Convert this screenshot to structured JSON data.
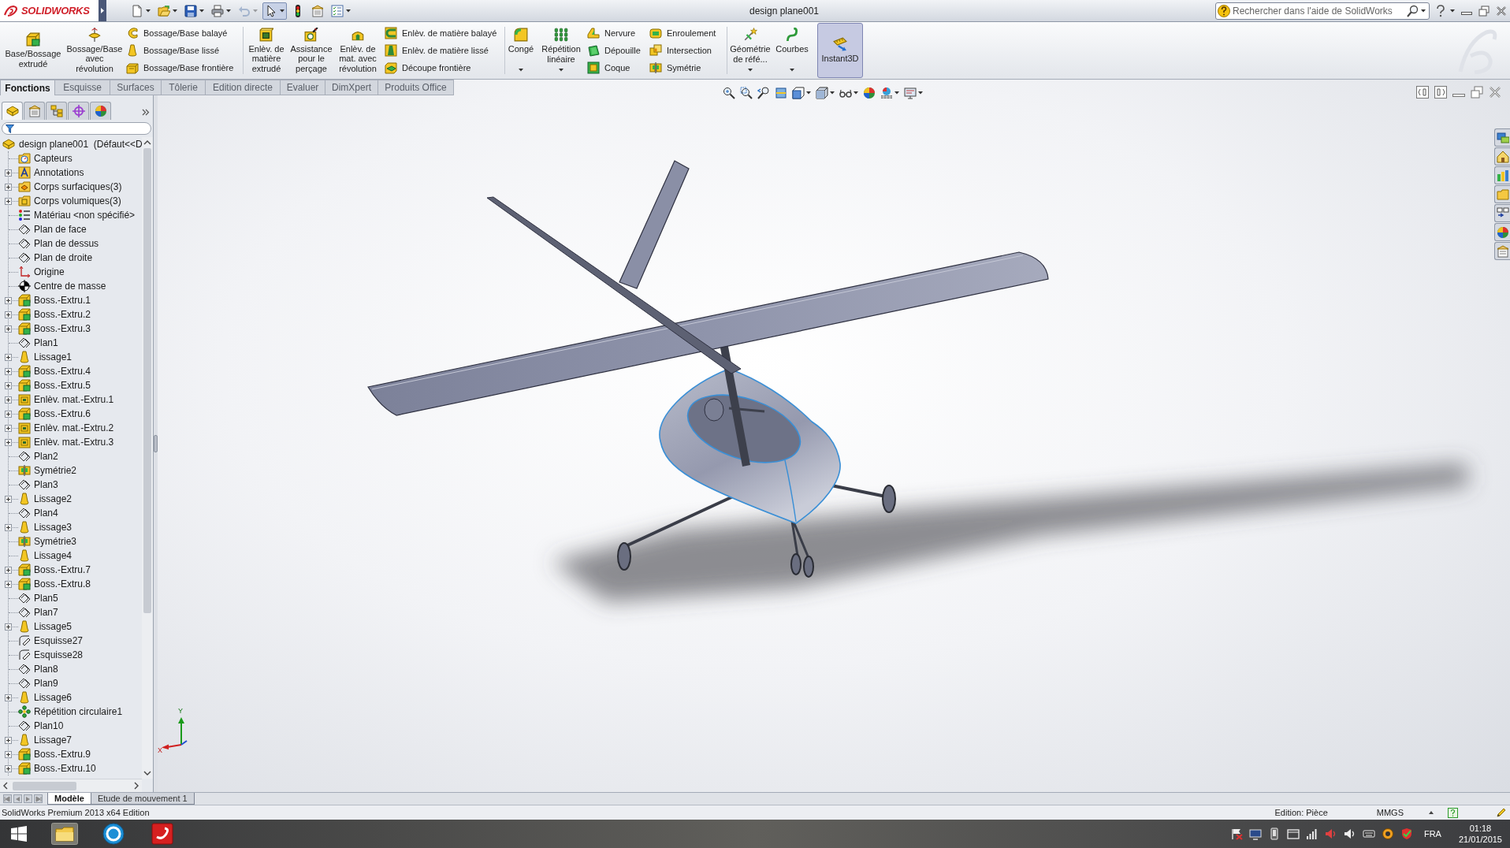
{
  "title_bar": {
    "logo": "SOLIDWORKS",
    "quick_access": [
      {
        "kind": "new",
        "dropdown": true,
        "on": false,
        "disabled": false
      },
      {
        "kind": "open",
        "dropdown": true,
        "on": false,
        "disabled": false
      },
      {
        "kind": "save",
        "dropdown": true,
        "on": false,
        "disabled": false
      },
      {
        "kind": "print",
        "dropdown": true,
        "on": false,
        "disabled": false
      },
      {
        "kind": "undo",
        "dropdown": true,
        "on": false,
        "disabled": true
      },
      {
        "kind": "select",
        "dropdown": true,
        "on": true,
        "disabled": false
      },
      {
        "kind": "rebuild",
        "dropdown": false,
        "on": false,
        "disabled": false
      },
      {
        "kind": "file-properties",
        "dropdown": false,
        "on": false,
        "disabled": false
      },
      {
        "kind": "options",
        "dropdown": true,
        "on": false,
        "disabled": false
      }
    ],
    "title": "design plane001",
    "search": {
      "placeholder": "Rechercher dans l'aide de SolidWorks"
    }
  },
  "ribbon": {
    "groups": [
      {
        "items": [
          {
            "kind": "large",
            "label": "Base/Bossage\nextrudé",
            "dropdown": false,
            "on": false
          },
          {
            "kind": "large",
            "label": "Bossage/Base\navec\nrévolution",
            "dropdown": false,
            "on": false
          },
          {
            "kind": "stack",
            "labels": [
              "Bossage/Base balayé",
              "Bossage/Base lissé",
              "Bossage/Base frontière"
            ]
          }
        ]
      },
      {
        "items": [
          {
            "kind": "large",
            "label": "Enlèv. de\nmatière\nextrudé",
            "dropdown": false,
            "on": false
          },
          {
            "kind": "large",
            "label": "Assistance\npour le\nperçage",
            "dropdown": false,
            "on": false
          },
          {
            "kind": "large",
            "label": "Enlèv. de\nmat. avec\nrévolution",
            "dropdown": false,
            "on": false
          },
          {
            "kind": "stack",
            "labels": [
              "Enlèv. de matière balayé",
              "Enlèv. de matière lissé",
              "Découpe frontière"
            ]
          }
        ]
      },
      {
        "items": [
          {
            "kind": "large",
            "label": "Congé",
            "dropdown": true,
            "on": false
          },
          {
            "kind": "large",
            "label": "Répétition\nlinéaire",
            "dropdown": true,
            "on": false
          },
          {
            "kind": "stack",
            "labels": [
              "Nervure",
              "Dépouille",
              "Coque"
            ]
          },
          {
            "kind": "stack",
            "labels": [
              "Enroulement",
              "Intersection",
              "Symétrie"
            ]
          }
        ]
      },
      {
        "items": [
          {
            "kind": "large",
            "label": "Géométrie\nde réfé...",
            "dropdown": true,
            "on": false
          },
          {
            "kind": "large",
            "label": "Courbes",
            "dropdown": true,
            "on": false
          },
          {
            "kind": "large",
            "label": "Instant3D",
            "dropdown": false,
            "on": true
          }
        ]
      }
    ]
  },
  "command_tabs": [
    {
      "label": "Fonctions",
      "selected": true
    },
    {
      "label": "Esquisse",
      "selected": false
    },
    {
      "label": "Surfaces",
      "selected": false
    },
    {
      "label": "Tôlerie",
      "selected": false
    },
    {
      "label": "Edition directe",
      "selected": false
    },
    {
      "label": "Evaluer",
      "selected": false
    },
    {
      "label": "DimXpert",
      "selected": false
    },
    {
      "label": "Produits Office",
      "selected": false
    }
  ],
  "feature_manager": {
    "tabs": [
      {
        "kind": "features",
        "selected": true
      },
      {
        "kind": "properties",
        "selected": false
      },
      {
        "kind": "configurations",
        "selected": false
      },
      {
        "kind": "dimxpert",
        "selected": false
      },
      {
        "kind": "display",
        "selected": false
      }
    ],
    "tree": {
      "label": "design plane001  (Défaut<<D",
      "kind": "part",
      "children": [
        {
          "label": "Capteurs",
          "kind": "sensors",
          "expandable": false
        },
        {
          "label": "Annotations",
          "kind": "annotations",
          "expandable": true
        },
        {
          "label": "Corps surfaciques(3)",
          "kind": "surface-bodies",
          "expandable": true
        },
        {
          "label": "Corps volumiques(3)",
          "kind": "solid-bodies",
          "expandable": true
        },
        {
          "label": "Matériau <non spécifié>",
          "kind": "material",
          "expandable": false
        },
        {
          "label": "Plan de face",
          "kind": "plane",
          "expandable": false
        },
        {
          "label": "Plan de dessus",
          "kind": "plane",
          "expandable": false
        },
        {
          "label": "Plan de droite",
          "kind": "plane",
          "expandable": false
        },
        {
          "label": "Origine",
          "kind": "origin",
          "expandable": false
        },
        {
          "label": "Centre de masse",
          "kind": "center-of-mass",
          "expandable": false
        },
        {
          "label": "Boss.-Extru.1",
          "kind": "extrude",
          "expandable": true
        },
        {
          "label": "Boss.-Extru.2",
          "kind": "extrude",
          "expandable": true
        },
        {
          "label": "Boss.-Extru.3",
          "kind": "extrude",
          "expandable": true
        },
        {
          "label": "Plan1",
          "kind": "plane",
          "expandable": false
        },
        {
          "label": "Lissage1",
          "kind": "loft",
          "expandable": true
        },
        {
          "label": "Boss.-Extru.4",
          "kind": "extrude",
          "expandable": true
        },
        {
          "label": "Boss.-Extru.5",
          "kind": "extrude",
          "expandable": true
        },
        {
          "label": "Enlèv. mat.-Extru.1",
          "kind": "cut",
          "expandable": true
        },
        {
          "label": "Boss.-Extru.6",
          "kind": "extrude",
          "expandable": true
        },
        {
          "label": "Enlèv. mat.-Extru.2",
          "kind": "cut",
          "expandable": true
        },
        {
          "label": "Enlèv. mat.-Extru.3",
          "kind": "cut",
          "expandable": true
        },
        {
          "label": "Plan2",
          "kind": "plane",
          "expandable": false
        },
        {
          "label": "Symétrie2",
          "kind": "mirror",
          "expandable": false
        },
        {
          "label": "Plan3",
          "kind": "plane",
          "expandable": false
        },
        {
          "label": "Lissage2",
          "kind": "loft",
          "expandable": true
        },
        {
          "label": "Plan4",
          "kind": "plane",
          "expandable": false
        },
        {
          "label": "Lissage3",
          "kind": "loft",
          "expandable": true
        },
        {
          "label": "Symétrie3",
          "kind": "mirror",
          "expandable": false
        },
        {
          "label": "Lissage4",
          "kind": "loft",
          "expandable": false
        },
        {
          "label": "Boss.-Extru.7",
          "kind": "extrude",
          "expandable": true
        },
        {
          "label": "Boss.-Extru.8",
          "kind": "extrude",
          "expandable": true
        },
        {
          "label": "Plan5",
          "kind": "plane",
          "expandable": false
        },
        {
          "label": "Plan7",
          "kind": "plane",
          "expandable": false
        },
        {
          "label": "Lissage5",
          "kind": "loft",
          "expandable": true
        },
        {
          "label": "Esquisse27",
          "kind": "sketch",
          "expandable": false
        },
        {
          "label": "Esquisse28",
          "kind": "sketch",
          "expandable": false
        },
        {
          "label": "Plan8",
          "kind": "plane",
          "expandable": false
        },
        {
          "label": "Plan9",
          "kind": "plane",
          "expandable": false
        },
        {
          "label": "Lissage6",
          "kind": "loft",
          "expandable": true
        },
        {
          "label": "Répétition circulaire1",
          "kind": "circular-pattern",
          "expandable": false
        },
        {
          "label": "Plan10",
          "kind": "plane",
          "expandable": false
        },
        {
          "label": "Lissage7",
          "kind": "loft",
          "expandable": true
        },
        {
          "label": "Boss.-Extru.9",
          "kind": "extrude",
          "expandable": true
        },
        {
          "label": "Boss.-Extru.10",
          "kind": "extrude",
          "expandable": true
        }
      ]
    }
  },
  "viewport": {
    "triad": [
      "Y",
      "X"
    ]
  },
  "model_tabs": [
    {
      "label": "Modèle",
      "selected": true
    },
    {
      "label": "Etude de mouvement 1",
      "selected": false
    }
  ],
  "status_bar": {
    "product": "SolidWorks Premium 2013 x64 Edition",
    "mode": "Edition: Pièce",
    "units": "MMGS"
  },
  "taskbar": {
    "language": "FRA",
    "time": "01:18",
    "date": "21/01/2015"
  }
}
